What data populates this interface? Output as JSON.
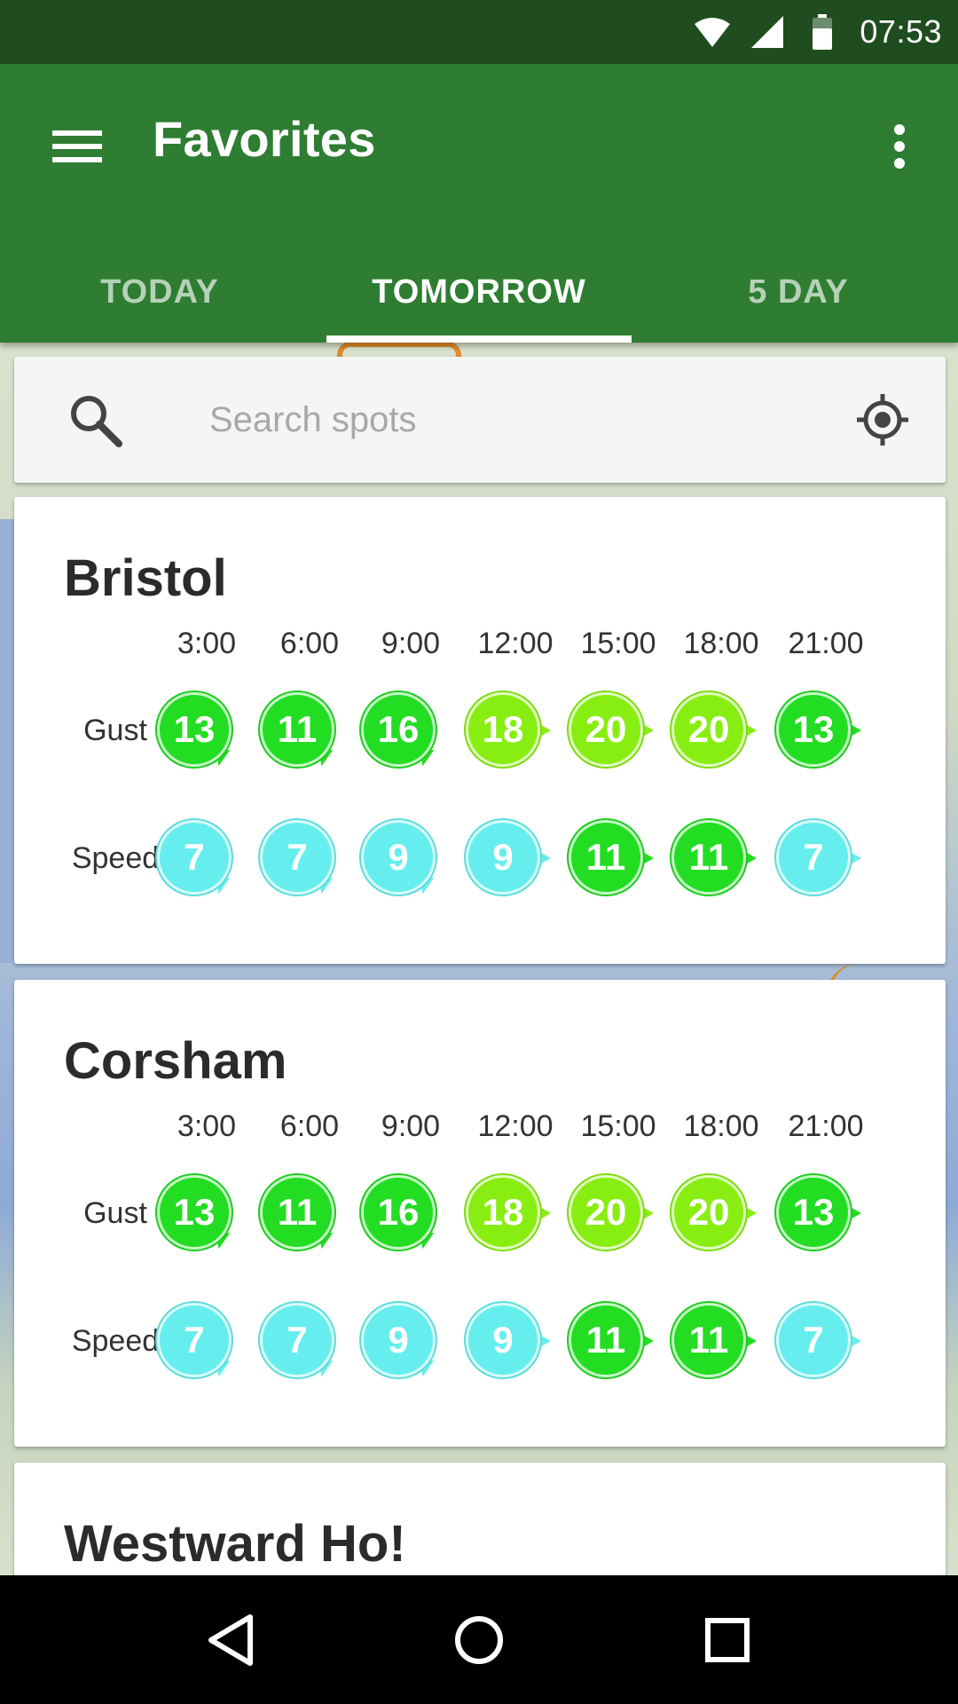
{
  "status_bar": {
    "time": "07:53"
  },
  "app_bar": {
    "title": "Favorites"
  },
  "tabs": [
    {
      "label": "TODAY",
      "active": false
    },
    {
      "label": "TOMORROW",
      "active": true
    },
    {
      "label": "5 DAY",
      "active": false
    }
  ],
  "search": {
    "placeholder": "Search spots",
    "value": ""
  },
  "spots": [
    {
      "name": "Bristol",
      "times": [
        "3:00",
        "6:00",
        "9:00",
        "12:00",
        "15:00",
        "18:00",
        "21:00"
      ],
      "gust_label": "Gust",
      "speed_label": "Speed",
      "gust": [
        13,
        11,
        16,
        18,
        20,
        20,
        13
      ],
      "speed": [
        7,
        7,
        9,
        9,
        11,
        11,
        7
      ]
    },
    {
      "name": "Corsham",
      "times": [
        "3:00",
        "6:00",
        "9:00",
        "12:00",
        "15:00",
        "18:00",
        "21:00"
      ],
      "gust_label": "Gust",
      "speed_label": "Speed",
      "gust": [
        13,
        11,
        16,
        18,
        20,
        20,
        13
      ],
      "speed": [
        7,
        7,
        9,
        9,
        11,
        11,
        7
      ]
    },
    {
      "name": "Westward Ho!"
    }
  ],
  "colors": {
    "status_bar": "#1f4d1f",
    "app_bar": "#2e7d32",
    "wind_green": "#22dd22",
    "wind_lime": "#88ee11",
    "wind_cyan": "#66eeee"
  }
}
